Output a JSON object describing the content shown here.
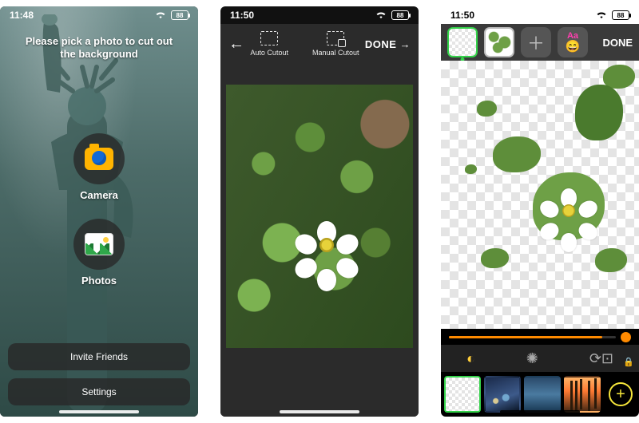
{
  "status": {
    "screen1_time": "11:48",
    "screen2_time": "11:50",
    "screen3_time": "11:50",
    "battery": "88"
  },
  "screen1": {
    "title_line1": "Please pick a photo to cut out",
    "title_line2": "the background",
    "camera_label": "Camera",
    "photos_label": "Photos",
    "invite_label": "Invite Friends",
    "settings_label": "Settings"
  },
  "screen2": {
    "auto_label": "Auto Cutout",
    "manual_label": "Manual Cutout",
    "done_label": "DONE"
  },
  "screen3": {
    "text_tool_label": "Aa",
    "done_label": "DONE",
    "slider_value": 92
  }
}
